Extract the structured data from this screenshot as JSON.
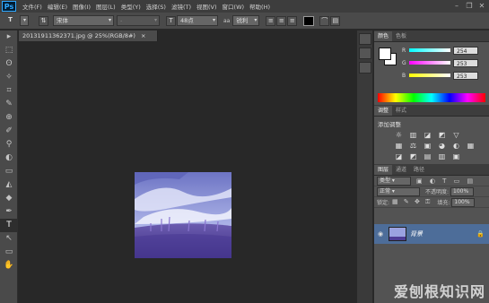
{
  "app": {
    "logo": "Ps"
  },
  "menu": [
    "文件(F)",
    "编辑(E)",
    "图像(I)",
    "图层(L)",
    "类型(Y)",
    "选择(S)",
    "滤镜(T)",
    "视图(V)",
    "窗口(W)",
    "帮助(H)"
  ],
  "window_controls": {
    "minimize": "–",
    "restore": "❐",
    "close": "✕"
  },
  "options": {
    "tool_icon": "T",
    "font_family": "宋体",
    "font_style": "-",
    "font_size": "48点",
    "aa_icon": "aa",
    "aa_mode": "锐利",
    "align_left": "≡",
    "align_center": "≡",
    "align_right": "≡"
  },
  "document": {
    "tab_label": "20131911362371.jpg @ 25%(RGB/8#)",
    "close": "×"
  },
  "tools": [
    "▸",
    "⬚",
    "ʘ",
    "✧",
    "⌗",
    "✎",
    "⊕",
    "✐",
    "⚲",
    "◐",
    "▭",
    "◭",
    "◆",
    "✒",
    "T",
    "↖",
    "▭",
    "✋"
  ],
  "color_panel": {
    "tabs": [
      "颜色",
      "色板"
    ],
    "channels": [
      {
        "label": "R",
        "value": "254",
        "gradient": "linear-gradient(to right,#00ffff,#ffffff)"
      },
      {
        "label": "G",
        "value": "253",
        "gradient": "linear-gradient(to right,#ff00ff,#ffffff)"
      },
      {
        "label": "B",
        "value": "253",
        "gradient": "linear-gradient(to right,#ffff00,#ffffff)"
      }
    ]
  },
  "adjust_panel": {
    "tabs": [
      "调整",
      "样式"
    ],
    "title": "添加调整",
    "icons": [
      "☼",
      "▥",
      "◪",
      "◩",
      "▽",
      "",
      "▦",
      "⚖",
      "▣",
      "◕",
      "◐",
      "▦",
      "◪",
      "◩",
      "▤",
      "▥",
      "▣",
      ""
    ]
  },
  "layers_panel": {
    "tabs": [
      "图层",
      "通道",
      "路径"
    ],
    "filter_label": "类型",
    "blend_mode": "正常",
    "opacity_label": "不透明度:",
    "opacity_value": "100%",
    "lock_label": "锁定:",
    "fill_label": "填充:",
    "fill_value": "100%",
    "layer_name": "背景",
    "eye": "👁",
    "lock_icon": "🔒"
  },
  "watermark": "爱刨根知识网",
  "colors": {
    "accent": "#31a8ff",
    "selected_layer": "#4d6d99"
  }
}
